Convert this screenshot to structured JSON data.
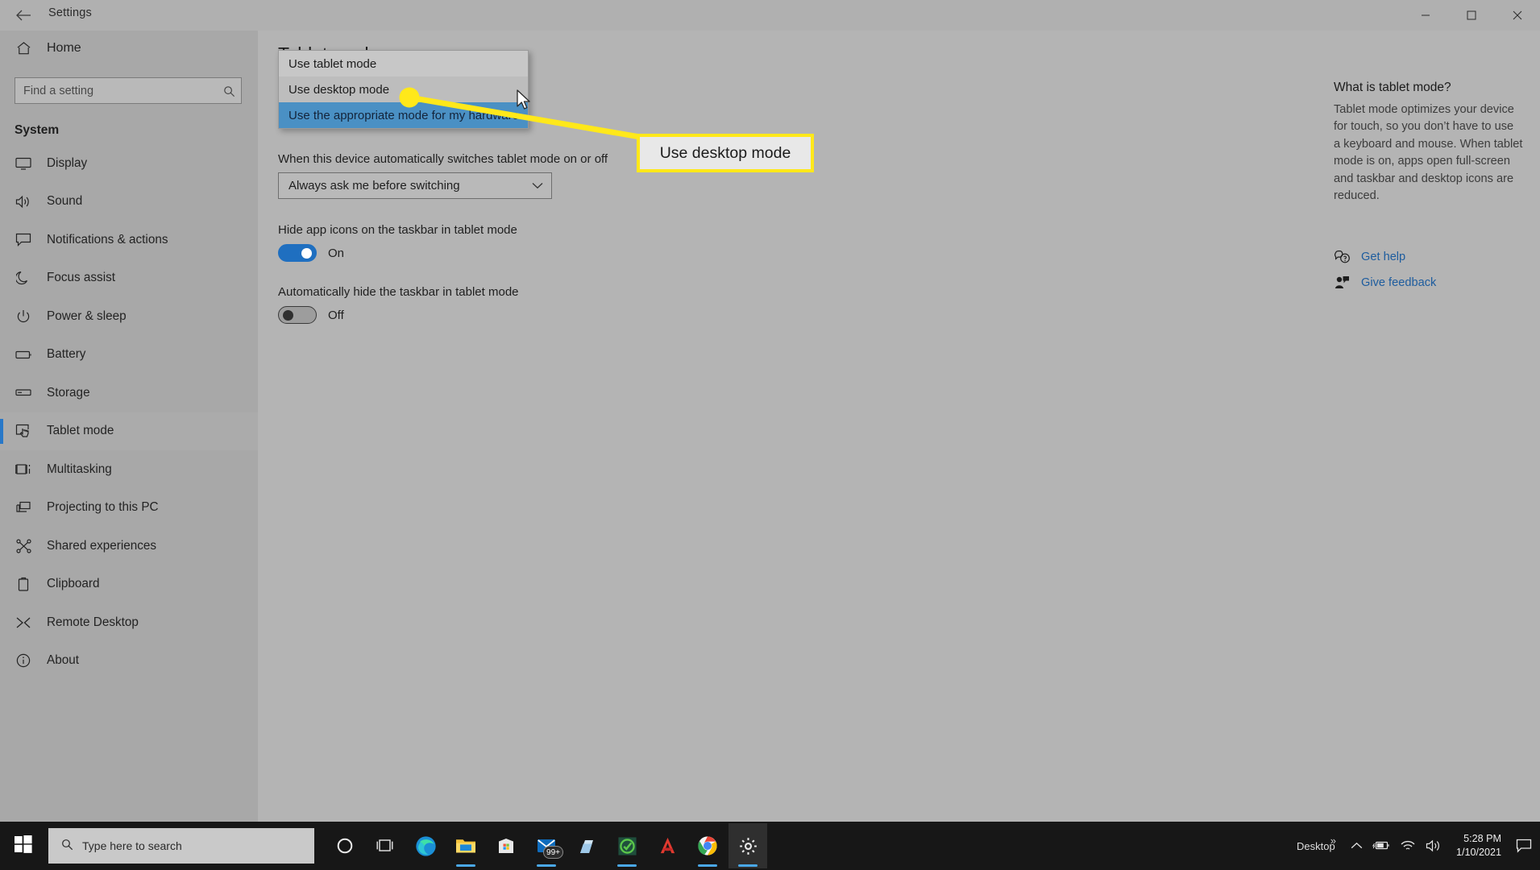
{
  "window": {
    "title": "Settings",
    "back_icon": "back-arrow-icon",
    "minimize_label": "—",
    "maximize_label": "☐",
    "close_label": "✕"
  },
  "sidebar": {
    "home_label": "Home",
    "home_icon": "home-icon",
    "search": {
      "placeholder": "Find a setting",
      "value": "",
      "icon": "search-icon"
    },
    "group_title": "System",
    "items": [
      {
        "label": "Display",
        "icon": "monitor-icon",
        "selected": false
      },
      {
        "label": "Sound",
        "icon": "speaker-icon",
        "selected": false
      },
      {
        "label": "Notifications & actions",
        "icon": "chat-bubble-icon",
        "selected": false
      },
      {
        "label": "Focus assist",
        "icon": "moon-icon",
        "selected": false
      },
      {
        "label": "Power & sleep",
        "icon": "power-icon",
        "selected": false
      },
      {
        "label": "Battery",
        "icon": "battery-icon",
        "selected": false
      },
      {
        "label": "Storage",
        "icon": "drive-icon",
        "selected": false
      },
      {
        "label": "Tablet mode",
        "icon": "tablet-hand-icon",
        "selected": true
      },
      {
        "label": "Multitasking",
        "icon": "multitask-icon",
        "selected": false
      },
      {
        "label": "Projecting to this PC",
        "icon": "project-screen-icon",
        "selected": false
      },
      {
        "label": "Shared experiences",
        "icon": "share-nodes-icon",
        "selected": false
      },
      {
        "label": "Clipboard",
        "icon": "clipboard-icon",
        "selected": false
      },
      {
        "label": "Remote Desktop",
        "icon": "remote-desktop-icon",
        "selected": false
      },
      {
        "label": "About",
        "icon": "info-icon",
        "selected": false
      }
    ]
  },
  "main": {
    "page_title": "Tablet mode",
    "auto_switch_label": "When this device automatically switches tablet mode on or off",
    "auto_switch_value": "Always ask me before switching",
    "hide_icons_label": "Hide app icons on the taskbar in tablet mode",
    "hide_icons_state": "On",
    "auto_hide_label": "Automatically hide the taskbar in tablet mode",
    "auto_hide_state": "Off"
  },
  "dropdown": {
    "items": [
      {
        "label": "Use tablet mode",
        "state": "normal"
      },
      {
        "label": "Use desktop mode",
        "state": "hover"
      },
      {
        "label": "Use the appropriate mode for my hardware",
        "state": "highlight"
      }
    ]
  },
  "annotation": {
    "callout_text": "Use desktop mode",
    "highlight_color": "#ffe81a"
  },
  "right_panel": {
    "title": "What is tablet mode?",
    "body": "Tablet mode optimizes your device for touch, so you don’t have to use a keyboard and mouse. When tablet mode is on, apps open full-screen and taskbar and desktop icons are reduced.",
    "links": [
      {
        "label": "Get help",
        "icon": "help-chat-icon"
      },
      {
        "label": "Give feedback",
        "icon": "feedback-person-icon"
      }
    ]
  },
  "taskbar": {
    "start_icon": "windows-start-icon",
    "search_placeholder": "Type here to search",
    "search_icon": "search-icon",
    "apps": [
      {
        "name": "cortana-icon",
        "badge": ""
      },
      {
        "name": "task-view-icon",
        "badge": ""
      },
      {
        "name": "microsoft-edge-icon",
        "badge": ""
      },
      {
        "name": "file-explorer-icon",
        "badge": ""
      },
      {
        "name": "microsoft-store-icon",
        "badge": ""
      },
      {
        "name": "mail-icon",
        "badge": "99+"
      },
      {
        "name": "onedrive-icon",
        "badge": ""
      },
      {
        "name": "quicken-icon",
        "badge": ""
      },
      {
        "name": "adobe-acrobat-icon",
        "badge": ""
      },
      {
        "name": "google-chrome-icon",
        "badge": ""
      },
      {
        "name": "settings-gear-icon",
        "badge": ""
      }
    ],
    "tray": {
      "desktop_label": "Desktop",
      "overflow_label": "»",
      "chevron_label": "⌃",
      "battery_icon": "battery-charging-icon",
      "wifi_icon": "wifi-icon",
      "volume_icon": "volume-icon",
      "time": "5:28 PM",
      "date": "1/10/2021",
      "action_center_icon": "action-center-icon"
    }
  }
}
